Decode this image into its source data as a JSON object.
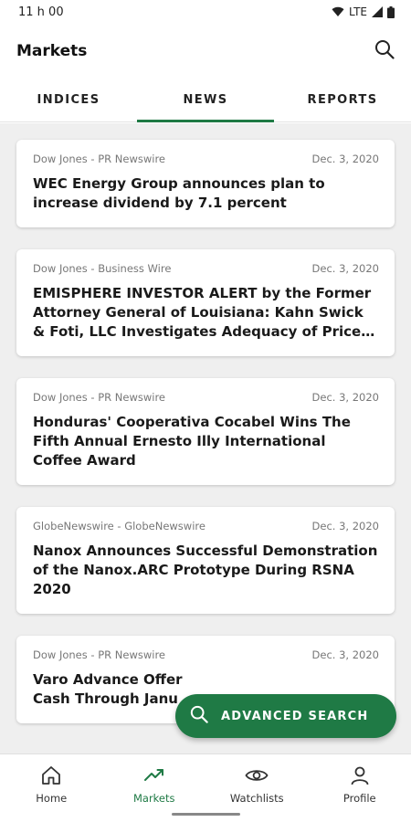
{
  "status_bar": {
    "time": "11 h 00",
    "network": "LTE"
  },
  "app_bar": {
    "title": "Markets",
    "search_icon": "search-icon"
  },
  "tabs": [
    {
      "label": "INDICES",
      "active": false
    },
    {
      "label": "NEWS",
      "active": true
    },
    {
      "label": "REPORTS",
      "active": false
    }
  ],
  "news": [
    {
      "source": "Dow Jones - PR Newswire",
      "date": "Dec. 3, 2020",
      "title": "WEC Energy Group announces plan to increase dividend by 7.1 percent"
    },
    {
      "source": "Dow Jones - Business Wire",
      "date": "Dec. 3, 2020",
      "title": "EMISPHERE INVESTOR ALERT by the Former Attorney General of Louisiana: Kahn Swick & Foti, LLC Investigates Adequacy of Price ..."
    },
    {
      "source": "Dow Jones - PR Newswire",
      "date": "Dec. 3, 2020",
      "title": "Honduras' Cooperativa Cocabel Wins The Fifth Annual Ernesto Illy International Coffee Award"
    },
    {
      "source": "GlobeNewswire - GlobeNewswire",
      "date": "Dec. 3, 2020",
      "title": "Nanox Announces Successful Demonstration of the Nanox.ARC Prototype During RSNA 2020"
    },
    {
      "source": "Dow Jones - PR Newswire",
      "date": "Dec. 3, 2020",
      "title": "Varo Advance Offer Cash Through Janu"
    }
  ],
  "fab": {
    "label": "ADVANCED SEARCH",
    "icon": "search-icon"
  },
  "bottom_nav": [
    {
      "label": "Home",
      "icon": "home-icon",
      "active": false
    },
    {
      "label": "Markets",
      "icon": "trending-up-icon",
      "active": true
    },
    {
      "label": "Watchlists",
      "icon": "eye-icon",
      "active": false
    },
    {
      "label": "Profile",
      "icon": "person-icon",
      "active": false
    }
  ],
  "colors": {
    "accent": "#1f7a45",
    "feed_background": "#efefef"
  }
}
